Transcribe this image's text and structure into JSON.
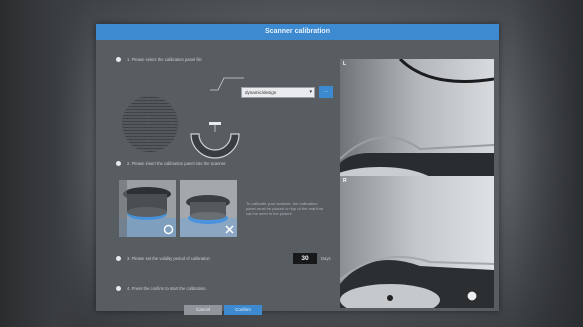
{
  "dialog": {
    "title": "Scanner calibration"
  },
  "steps": [
    {
      "text": "1. Please select the calibration panel file"
    },
    {
      "text": "2. Please insert the calibration panel into the scanner."
    },
    {
      "text": "3. Please set the validity period of calibration"
    },
    {
      "text": "4. Press the confirm to start the calibration."
    }
  ],
  "panel_file": {
    "selected": "dynamic/design",
    "browse_label": "..."
  },
  "hint_text": "To calibrate your scanner, the calibration panel must be placed on top of the mat that can be seen in the picture",
  "validity": {
    "value": "30",
    "unit_label": "Days"
  },
  "buttons": {
    "cancel_label": "Cancel",
    "confirm_label": "Confirm"
  },
  "scan_views": {
    "left_label": "L",
    "right_label": "R"
  },
  "colors": {
    "accent": "#3d8ad0",
    "dialog_bg": "#585d62"
  },
  "icons": {
    "correct_mark": "check-circle-icon",
    "wrong_mark": "x-icon"
  }
}
